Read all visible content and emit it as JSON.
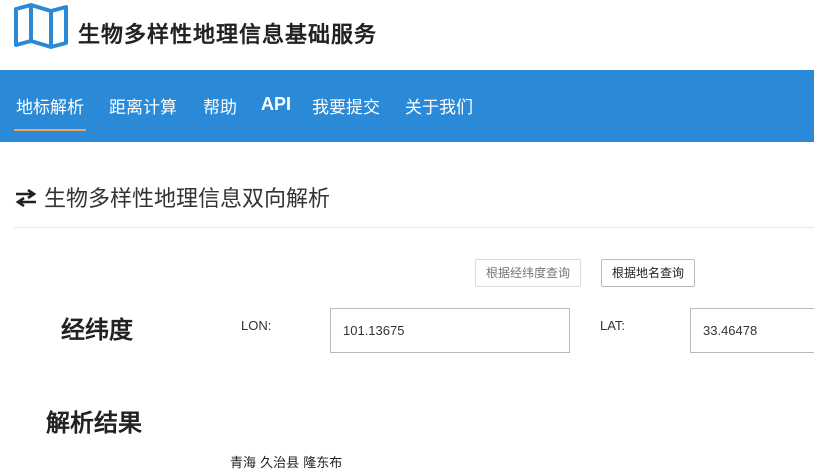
{
  "header": {
    "title": "生物多样性地理信息基础服务",
    "logo_icon": "folded-map-icon",
    "brand_color": "#2a8ad8"
  },
  "nav": {
    "items": [
      {
        "label": "地标解析",
        "active": true
      },
      {
        "label": "距离计算"
      },
      {
        "label": "帮助"
      },
      {
        "label": "API"
      },
      {
        "label": "我要提交"
      },
      {
        "label": "关于我们"
      }
    ],
    "active_underline_color": "#f0a35a"
  },
  "main": {
    "heading": "生物多样性地理信息双向解析",
    "heading_icon": "swap-arrows-icon",
    "buttons": {
      "by_coordinates": "根据经纬度查询",
      "by_place_name": "根据地名查询"
    },
    "coord_label": "经纬度",
    "lon": {
      "label": "LON:",
      "value": "101.13675"
    },
    "lat": {
      "label": "LAT:",
      "value": "33.46478"
    },
    "result_label": "解析结果",
    "result_text": "青海 久治县 隆东布"
  }
}
